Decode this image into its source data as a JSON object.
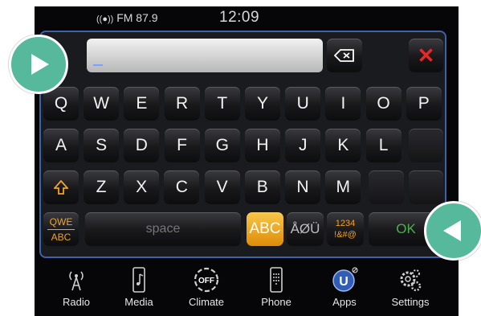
{
  "status_bar": {
    "radio_icon": "broadcast-icon",
    "radio": "FM 87.9",
    "time": "12:09"
  },
  "keyboard": {
    "input_value": "",
    "backspace_icon": "backspace-icon",
    "close_icon": "close-icon",
    "rows": [
      [
        "Q",
        "W",
        "E",
        "R",
        "T",
        "Y",
        "U",
        "I",
        "O",
        "P"
      ],
      [
        "A",
        "S",
        "D",
        "F",
        "G",
        "H",
        "J",
        "K",
        "L"
      ],
      [
        "Z",
        "X",
        "C",
        "V",
        "B",
        "N",
        "M"
      ]
    ],
    "shift_icon": "shift-icon",
    "mode_top": "QWE",
    "mode_bottom": "ABC",
    "space": "space",
    "abc": "ABC",
    "accents": "ÅØÜ",
    "symbols_top": "1234",
    "symbols_bottom": "!&#@",
    "ok": "OK"
  },
  "nav": [
    {
      "label": "Radio",
      "icon": "radio-tower-icon"
    },
    {
      "label": "Media",
      "icon": "media-device-icon"
    },
    {
      "label": "Climate",
      "icon": "climate-off-icon"
    },
    {
      "label": "Phone",
      "icon": "phone-keypad-icon"
    },
    {
      "label": "Apps",
      "icon": "apps-icon"
    },
    {
      "label": "Settings",
      "icon": "settings-gear-icon"
    }
  ],
  "colors": {
    "accent_orange": "#f0a327",
    "border_blue": "#3b63a8",
    "ok_green": "#4cb04c",
    "close_red": "#e32b2b",
    "pointer_teal": "#56b99b"
  }
}
